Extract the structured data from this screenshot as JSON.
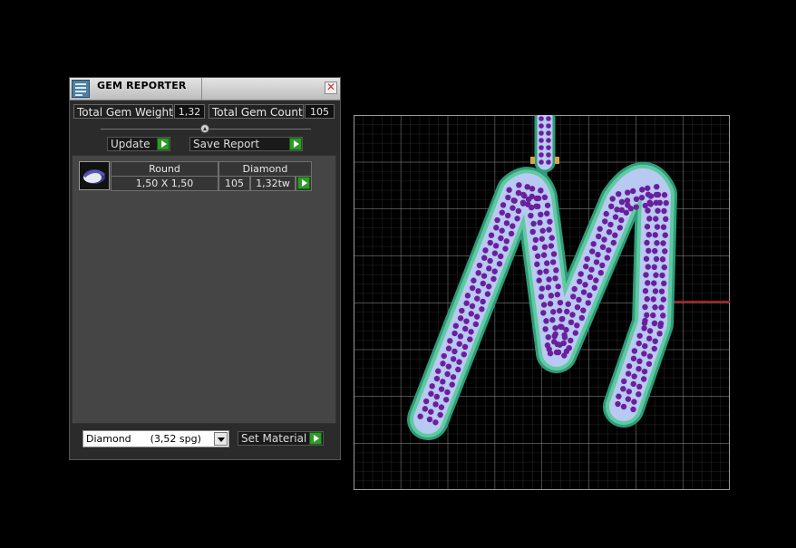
{
  "panel": {
    "title": "GEM REPORTER",
    "close_glyph": "✕",
    "total_weight_label": "Total Gem Weight",
    "total_weight_value": "1,32",
    "total_count_label": "Total Gem Count",
    "total_count_value": "105",
    "update_label": "Update",
    "save_label": "Save Report",
    "set_material_label": "Set Material",
    "material_selected": "Diamond      (3,52 spg)"
  },
  "gem_table": {
    "rows": [
      {
        "shape": "Round",
        "material": "Diamond",
        "size": "1,50 X 1,50",
        "count": "105",
        "weight": "1,32tw"
      }
    ]
  },
  "icons": {
    "app": "gem-reporter-app-icon",
    "close": "close-icon",
    "slider": "slider-knob",
    "go": "green-arrow-icon",
    "dropdown": "chevron-down-icon",
    "gem": "round-gem-icon"
  },
  "colors": {
    "panel_bg": "#2b2b2b",
    "list_bg": "#454545",
    "grid_line": "#8a8a8a",
    "outline_green": "#2e9c7a",
    "fill_lavender": "#b8c9f2",
    "gem_purple": "#6a1f9c",
    "axis_red": "#b01818"
  }
}
